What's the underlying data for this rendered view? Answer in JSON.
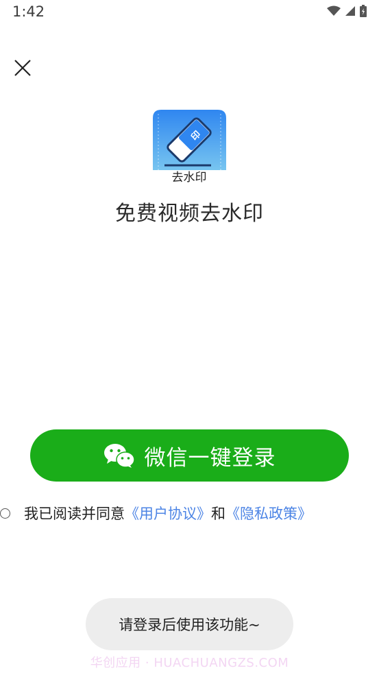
{
  "status_bar": {
    "time": "1:42"
  },
  "logo": {
    "caption": "去水印",
    "eraser_glyph": "印"
  },
  "app": {
    "title": "免费视频去水印"
  },
  "login": {
    "wechat_button_label": "微信一键登录"
  },
  "agreement": {
    "prefix": "我已阅读并同意",
    "user_agreement": "《用户协议》",
    "conjunction": "和",
    "privacy_policy": "《隐私政策》"
  },
  "toast": {
    "message": "请登录后使用该功能~"
  },
  "watermark": {
    "text": "华创应用 · HUACHUANGZS.COM"
  },
  "colors": {
    "wechat_green": "#1aad19",
    "link_blue": "#4c84e5",
    "logo_blue": "#3d8ef2"
  }
}
